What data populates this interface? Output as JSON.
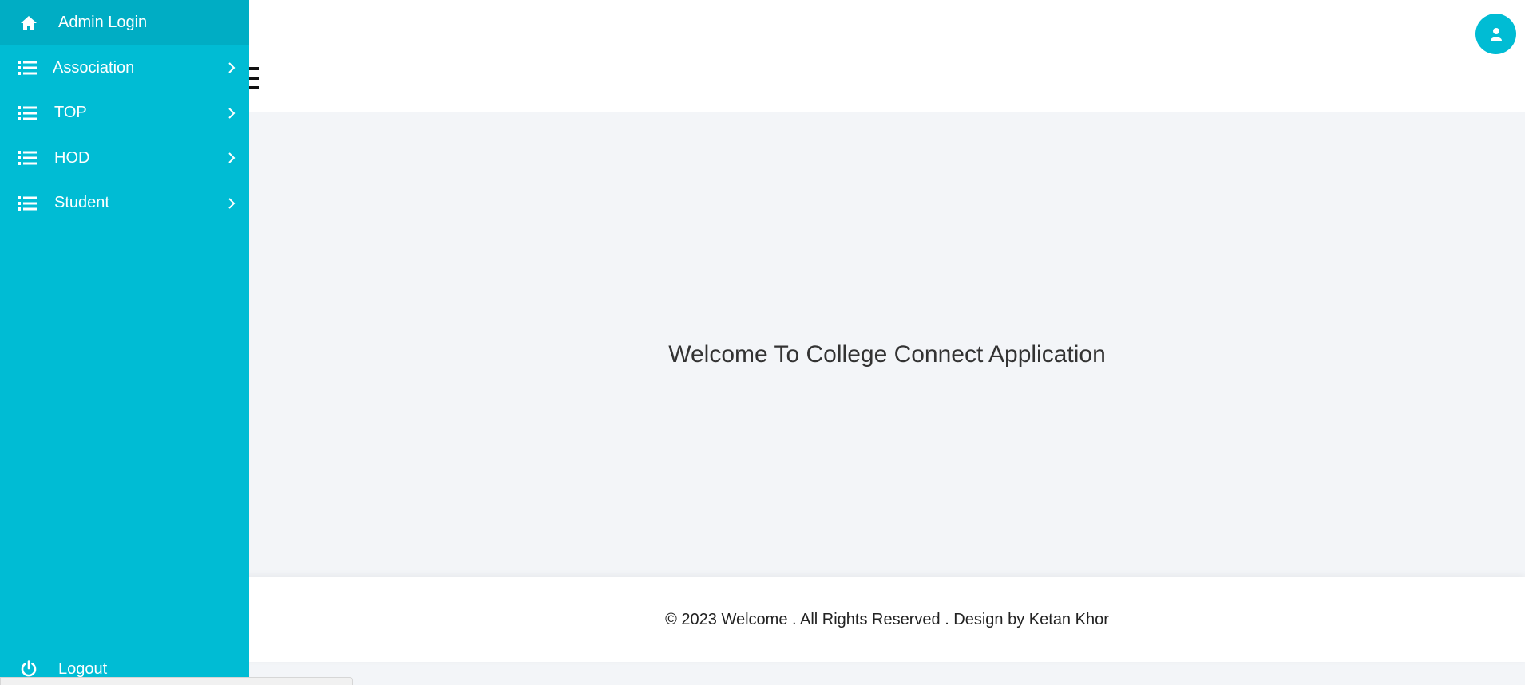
{
  "sidebar": {
    "header": {
      "label": "Admin Login",
      "icon": "home-icon"
    },
    "items": [
      {
        "label": "Association",
        "icon": "list-icon"
      },
      {
        "label": "TOP",
        "icon": "list-icon"
      },
      {
        "label": "HOD",
        "icon": "list-icon"
      },
      {
        "label": "Student",
        "icon": "list-icon"
      }
    ],
    "logout": {
      "label": "Logout",
      "icon": "power-icon"
    }
  },
  "header": {
    "user_icon": "user-icon"
  },
  "main": {
    "welcome": "Welcome To College Connect Application"
  },
  "footer": {
    "text": "© 2023 Welcome . All Rights Reserved . Design by Ketan Khor"
  },
  "colors": {
    "accent": "#00bcd4",
    "accent_dark": "#00adc4",
    "background": "#f3f5f8"
  }
}
